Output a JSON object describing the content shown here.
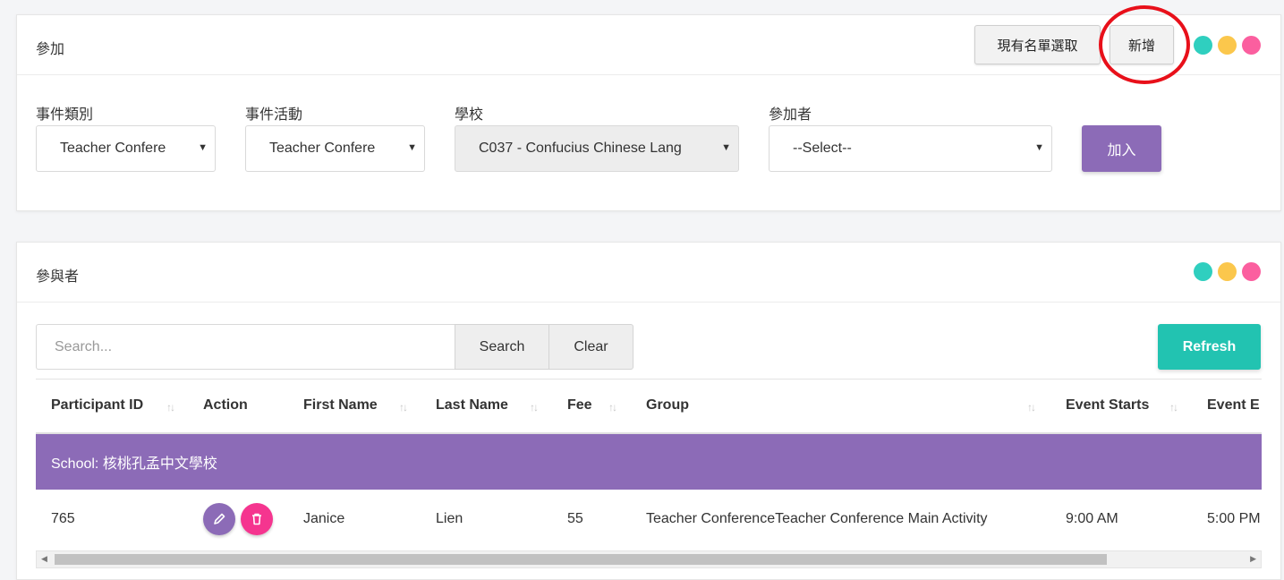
{
  "add_panel": {
    "title": "參加",
    "existing_list_button": "現有名單選取",
    "add_new_button": "新增",
    "fields": {
      "event_category": {
        "label": "事件類別",
        "value": "Teacher Confere"
      },
      "event_activity": {
        "label": "事件活動",
        "value": "Teacher Confere"
      },
      "school": {
        "label": "學校",
        "value": "C037 - Confucius Chinese Lang"
      },
      "participant": {
        "label": "參加者",
        "value": "--Select--"
      }
    },
    "join_button": "加入"
  },
  "participants_panel": {
    "title": "參與者",
    "search": {
      "placeholder": "Search...",
      "search_button": "Search",
      "clear_button": "Clear"
    },
    "refresh_button": "Refresh",
    "columns": [
      "Participant ID",
      "Action",
      "First Name",
      "Last Name",
      "Fee",
      "Group",
      "Event Starts",
      "Event E"
    ],
    "group_label": "School: 核桃孔孟中文學校",
    "rows": [
      {
        "participant_id": "765",
        "first_name": "Janice",
        "last_name": "Lien",
        "fee": "55",
        "group": "Teacher ConferenceTeacher Conference Main Activity",
        "event_starts": "9:00 AM",
        "event_ends": "5:00 PM"
      }
    ]
  },
  "colors": {
    "dot_teal": "#2fcfbf",
    "dot_yellow": "#fbc74c",
    "dot_pink": "#fb5f9f",
    "purple": "#8c6bb7",
    "teal_button": "#22c3b1",
    "delete_pink": "#f5358f",
    "highlight_red": "#e8101a"
  },
  "icons": {
    "edit": "pencil-icon",
    "delete": "trash-icon",
    "select_arrow": "caret-down-icon",
    "sort": "sort-icon"
  }
}
